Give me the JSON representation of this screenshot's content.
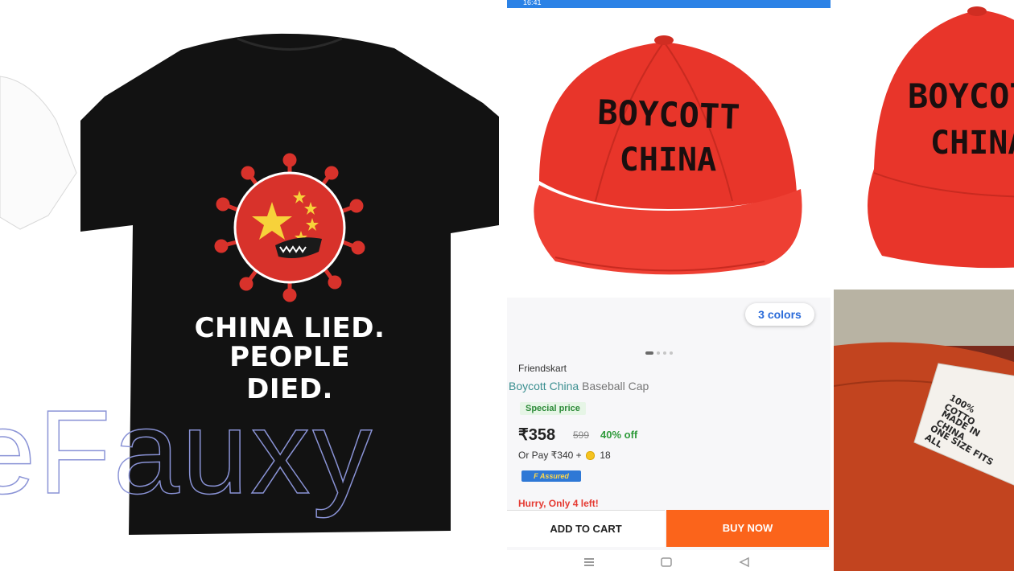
{
  "tshirt": {
    "line1": "CHINA LIED.",
    "line2": "PEOPLE DIED.",
    "watermark": "eFauxy",
    "shirt_color": "#121212",
    "virus_color": "#d8322b",
    "star_color": "#f7d23a"
  },
  "phone": {
    "status_time": "16:41",
    "cap_line1": "BOYCOTT",
    "cap_line2": "CHINA",
    "cap_color": "#e8352a",
    "colors_label": "3 colors",
    "seller": "Friendskart",
    "title_highlight": "Boycott China",
    "title_rest": "Baseball Cap",
    "special_label": "Special price",
    "price": "₹358",
    "mrp": "599",
    "discount": "40% off",
    "or_pay_prefix": "Or Pay ₹340 +",
    "or_pay_coins": "18",
    "assured_label": "F Assured",
    "hurry": "Hurry, Only 4 left!",
    "add_to_cart": "ADD TO CART",
    "buy_now": "BUY NOW",
    "buy_color": "#fb641b"
  },
  "cap_crop": {
    "line1": "BOYCOT",
    "line2": "CHINA"
  },
  "tag": {
    "line1": "100% COTTO",
    "line2": "MADE IN CHINA",
    "line3": "ONE SIZE FITS ALL"
  }
}
